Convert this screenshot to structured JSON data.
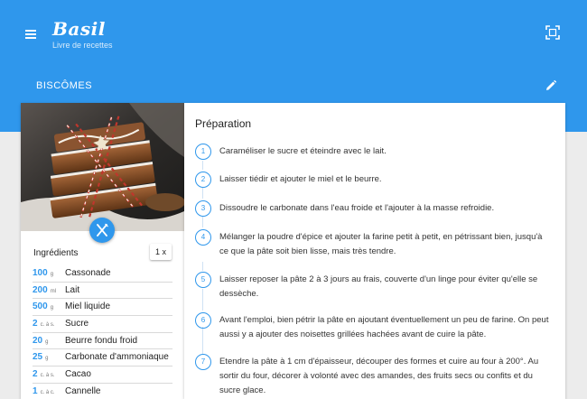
{
  "app": {
    "title": "Basil",
    "subtitle": "Livre de recettes"
  },
  "recipe": {
    "title": "BISCÔMES",
    "servings_button": "1 x"
  },
  "ingredients": {
    "heading": "Ingrédients",
    "items": [
      {
        "qty": "100",
        "unit": "g",
        "name": "Cassonade"
      },
      {
        "qty": "200",
        "unit": "ml",
        "name": "Lait"
      },
      {
        "qty": "500",
        "unit": "g",
        "name": "Miel liquide"
      },
      {
        "qty": "2",
        "unit": "c. à s.",
        "name": "Sucre"
      },
      {
        "qty": "20",
        "unit": "g",
        "name": "Beurre fondu froid"
      },
      {
        "qty": "25",
        "unit": "g",
        "name": "Carbonate d'ammoniaque"
      },
      {
        "qty": "2",
        "unit": "c. à s.",
        "name": "Cacao"
      },
      {
        "qty": "1",
        "unit": "c. à c.",
        "name": "Cannelle"
      }
    ]
  },
  "preparation": {
    "heading": "Préparation",
    "steps": [
      {
        "num": "1",
        "text": "Caraméliser le sucre et éteindre avec le lait."
      },
      {
        "num": "2",
        "text": "Laisser tiédir et ajouter le miel et le beurre."
      },
      {
        "num": "3",
        "text": "Dissoudre le carbonate dans l'eau froide et l'ajouter à la masse refroidie."
      },
      {
        "num": "4",
        "text": "Mélanger la poudre d'épice et ajouter la farine petit à petit, en pétrissant bien, jusqu'à ce que la pâte soit bien lisse, mais très tendre."
      },
      {
        "num": "5",
        "text": "Laisser reposer la pâte 2 à 3 jours au frais, couverte d'un linge pour éviter qu'elle se dessèche."
      },
      {
        "num": "6",
        "text": "Avant l'emploi, bien pétrir la pâte en ajoutant éventuellement un peu de farine. On peut aussi y a ajouter des noisettes grillées hachées avant de cuire la pâte."
      },
      {
        "num": "7",
        "text": "Etendre la pâte à 1 cm d'épaisseur, découper des formes et cuire au four à 200°. Au sortir du four, décorer à volonté avec des amandes, des fruits secs ou confits et du sucre glace."
      }
    ]
  },
  "icons": {
    "menu": "menu-icon",
    "fullscreen": "fullscreen-icon",
    "edit": "pencil-icon",
    "utensils": "fork-knife-icon"
  },
  "colors": {
    "primary": "#2f97ec",
    "background": "#ececec",
    "card": "#ffffff"
  }
}
